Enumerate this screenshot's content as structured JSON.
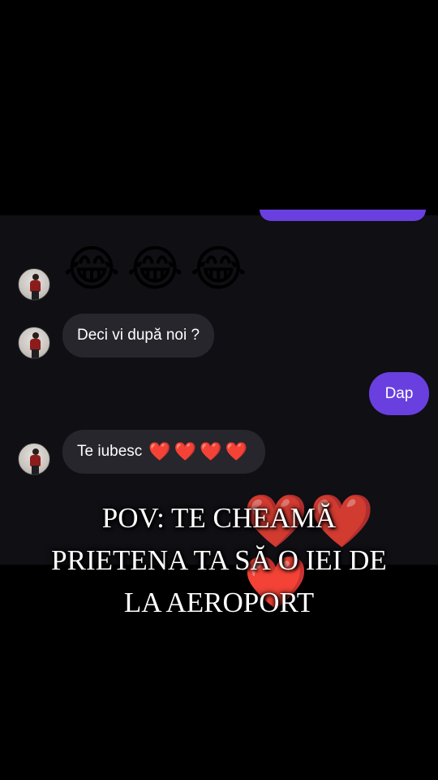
{
  "colors": {
    "background": "#000000",
    "chat_background": "#0f0f14",
    "incoming_bubble": "#26262c",
    "outgoing_bubble": "#6a3fe0",
    "heart": "#e3192b",
    "text": "#ffffff"
  },
  "messages": [
    {
      "direction": "incoming",
      "type": "emoji",
      "text": "😂😂😂",
      "icon": "tears-of-joy-emoji"
    },
    {
      "direction": "incoming",
      "type": "text",
      "text": "Deci vi după noi ?"
    },
    {
      "direction": "outgoing",
      "type": "text",
      "text": "Dap"
    },
    {
      "direction": "incoming",
      "type": "text",
      "text": "Te iubesc",
      "hearts": "❤️❤️❤️❤️"
    }
  ],
  "overlay": {
    "hearts": [
      "❤️",
      "❤️",
      "❤️"
    ],
    "caption_lines": [
      "POV: TE CHEAMĂ",
      "PRIETENA TA SĂ O IEI DE",
      "LA AEROPORT"
    ]
  }
}
